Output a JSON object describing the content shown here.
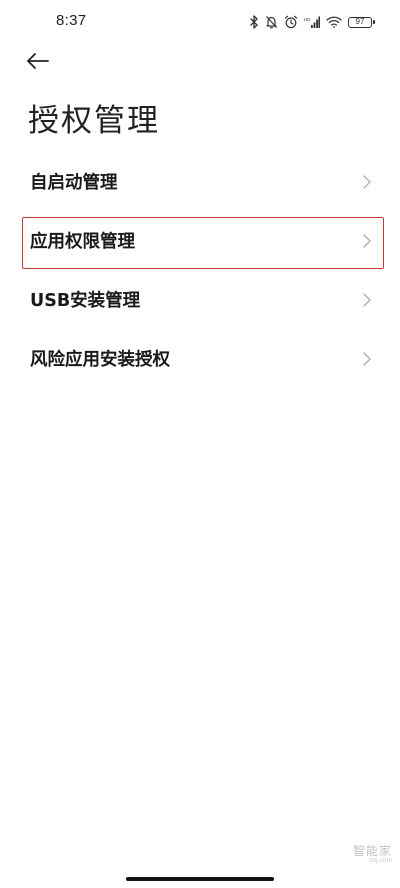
{
  "status_bar": {
    "time": "8:37",
    "battery_level": "97",
    "icons": [
      "bluetooth-icon",
      "mute-icon",
      "alarm-icon",
      "signal-icon",
      "wifi-icon",
      "battery-icon"
    ]
  },
  "header": {
    "back_icon": "back-arrow-icon",
    "title": "授权管理"
  },
  "menu": {
    "items": [
      {
        "label": "自启动管理",
        "highlighted": false
      },
      {
        "label": "应用权限管理",
        "highlighted": true
      },
      {
        "label": "USB安装管理",
        "highlighted": false
      },
      {
        "label": "风险应用安装授权",
        "highlighted": false
      }
    ]
  },
  "watermark": {
    "main": "智能家",
    "sub": "znj.com"
  },
  "colors": {
    "background": "#ffffff",
    "text": "#1a1a1a",
    "chevron": "#b0b0b0",
    "highlight_border": "#c33a34"
  }
}
